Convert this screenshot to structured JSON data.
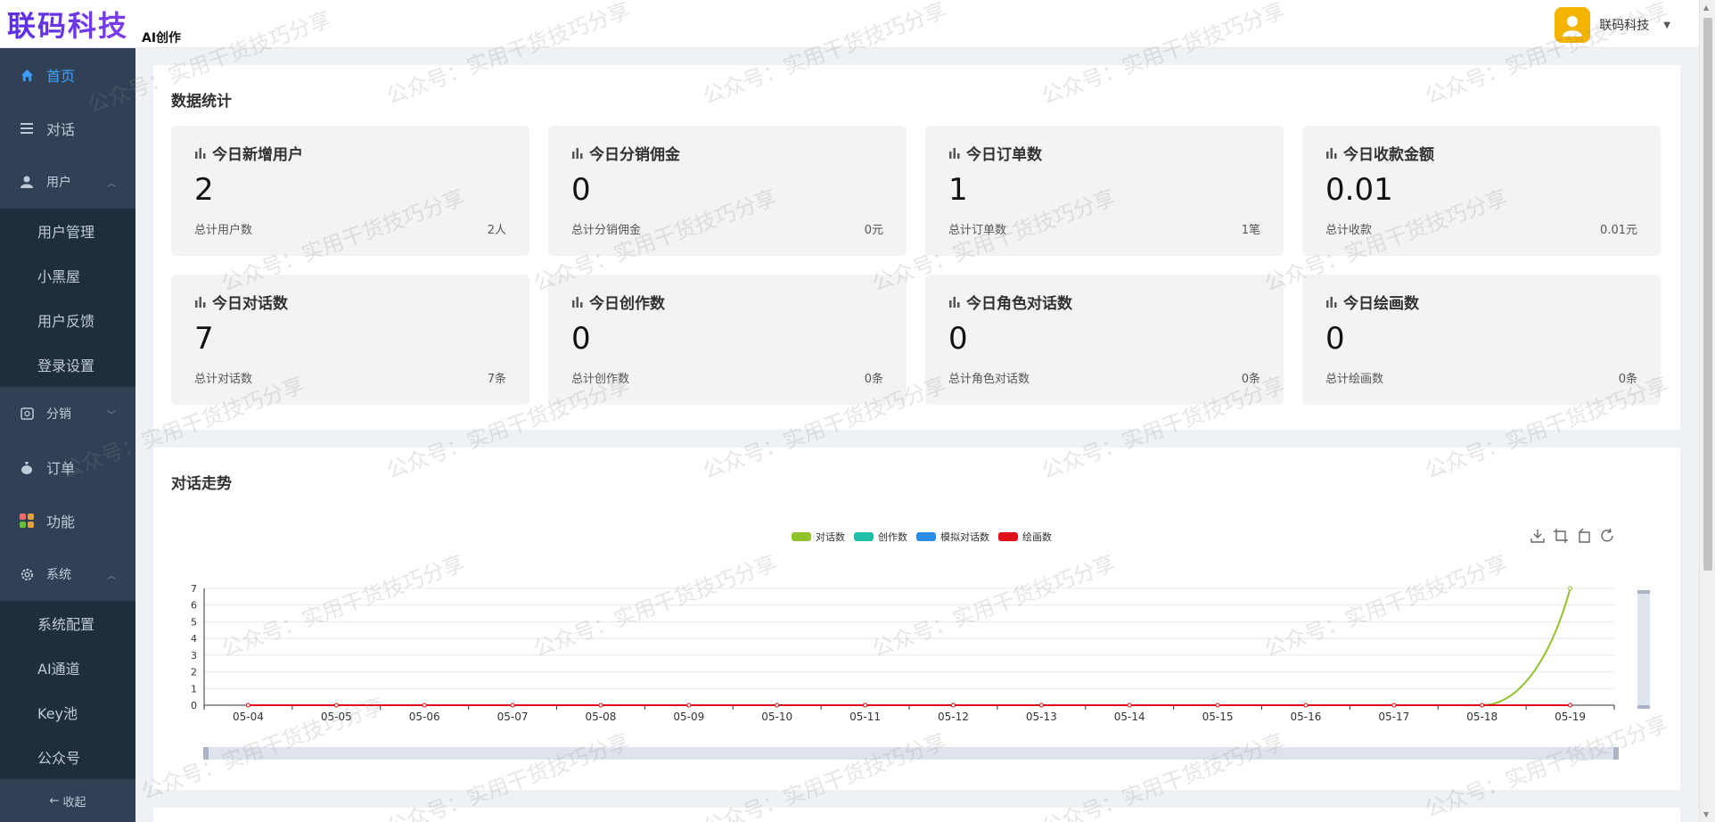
{
  "header": {
    "logo": "联码科技",
    "subtitle": "AI创作",
    "user_name": "联码科技"
  },
  "sidebar": {
    "items": [
      {
        "label": "首页",
        "icon": "home-icon"
      },
      {
        "label": "对话",
        "icon": "list-icon"
      },
      {
        "label": "用户",
        "icon": "user-icon"
      },
      {
        "label": "分销",
        "icon": "share-icon"
      },
      {
        "label": "订单",
        "icon": "money-bag-icon"
      },
      {
        "label": "功能",
        "icon": "grid-icon"
      },
      {
        "label": "系统",
        "icon": "gear-icon"
      }
    ],
    "user_sub": [
      "用户管理",
      "小黑屋",
      "用户反馈",
      "登录设置"
    ],
    "system_sub": [
      "系统配置",
      "AI通道",
      "Key池",
      "公众号"
    ],
    "collapse_label": "收起"
  },
  "stats_card": {
    "title": "数据统计",
    "items": [
      {
        "title": "今日新增用户",
        "value": "2",
        "foot_label": "总计用户数",
        "foot_value": "2人"
      },
      {
        "title": "今日分销佣金",
        "value": "0",
        "foot_label": "总计分销佣金",
        "foot_value": "0元"
      },
      {
        "title": "今日订单数",
        "value": "1",
        "foot_label": "总计订单数",
        "foot_value": "1笔"
      },
      {
        "title": "今日收款金额",
        "value": "0.01",
        "foot_label": "总计收款",
        "foot_value": "0.01元"
      },
      {
        "title": "今日对话数",
        "value": "7",
        "foot_label": "总计对话数",
        "foot_value": "7条"
      },
      {
        "title": "今日创作数",
        "value": "0",
        "foot_label": "总计创作数",
        "foot_value": "0条"
      },
      {
        "title": "今日角色对话数",
        "value": "0",
        "foot_label": "总计角色对话数",
        "foot_value": "0条"
      },
      {
        "title": "今日绘画数",
        "value": "0",
        "foot_label": "总计绘画数",
        "foot_value": "0条"
      }
    ]
  },
  "chart_card": {
    "title": "对话走势"
  },
  "watermark": "公众号：实用干货技巧分享",
  "colors": {
    "sidebar_bg": "#304156",
    "sidebar_sub_bg": "#1f2d3d",
    "active": "#409eff",
    "series_chat": "#91c22e",
    "series_create": "#20c0a8",
    "series_role": "#2a8ee6",
    "series_draw": "#e0101a"
  },
  "chart_data": {
    "type": "line",
    "x": [
      "05-04",
      "05-05",
      "05-06",
      "05-07",
      "05-08",
      "05-09",
      "05-10",
      "05-11",
      "05-12",
      "05-13",
      "05-14",
      "05-15",
      "05-16",
      "05-17",
      "05-18",
      "05-19"
    ],
    "series": [
      {
        "name": "对话数",
        "color": "#91c22e",
        "values": [
          0,
          0,
          0,
          0,
          0,
          0,
          0,
          0,
          0,
          0,
          0,
          0,
          0,
          0,
          0,
          7
        ]
      },
      {
        "name": "创作数",
        "color": "#20c0a8",
        "values": [
          0,
          0,
          0,
          0,
          0,
          0,
          0,
          0,
          0,
          0,
          0,
          0,
          0,
          0,
          0,
          0
        ]
      },
      {
        "name": "模拟对话数",
        "color": "#2a8ee6",
        "values": [
          0,
          0,
          0,
          0,
          0,
          0,
          0,
          0,
          0,
          0,
          0,
          0,
          0,
          0,
          0,
          0
        ]
      },
      {
        "name": "绘画数",
        "color": "#e0101a",
        "values": [
          0,
          0,
          0,
          0,
          0,
          0,
          0,
          0,
          0,
          0,
          0,
          0,
          0,
          0,
          0,
          0
        ]
      }
    ],
    "yticks": [
      0,
      1,
      2,
      3,
      4,
      5,
      6,
      7
    ],
    "ylim": [
      0,
      7
    ],
    "grid": true,
    "legend": "top-center"
  }
}
